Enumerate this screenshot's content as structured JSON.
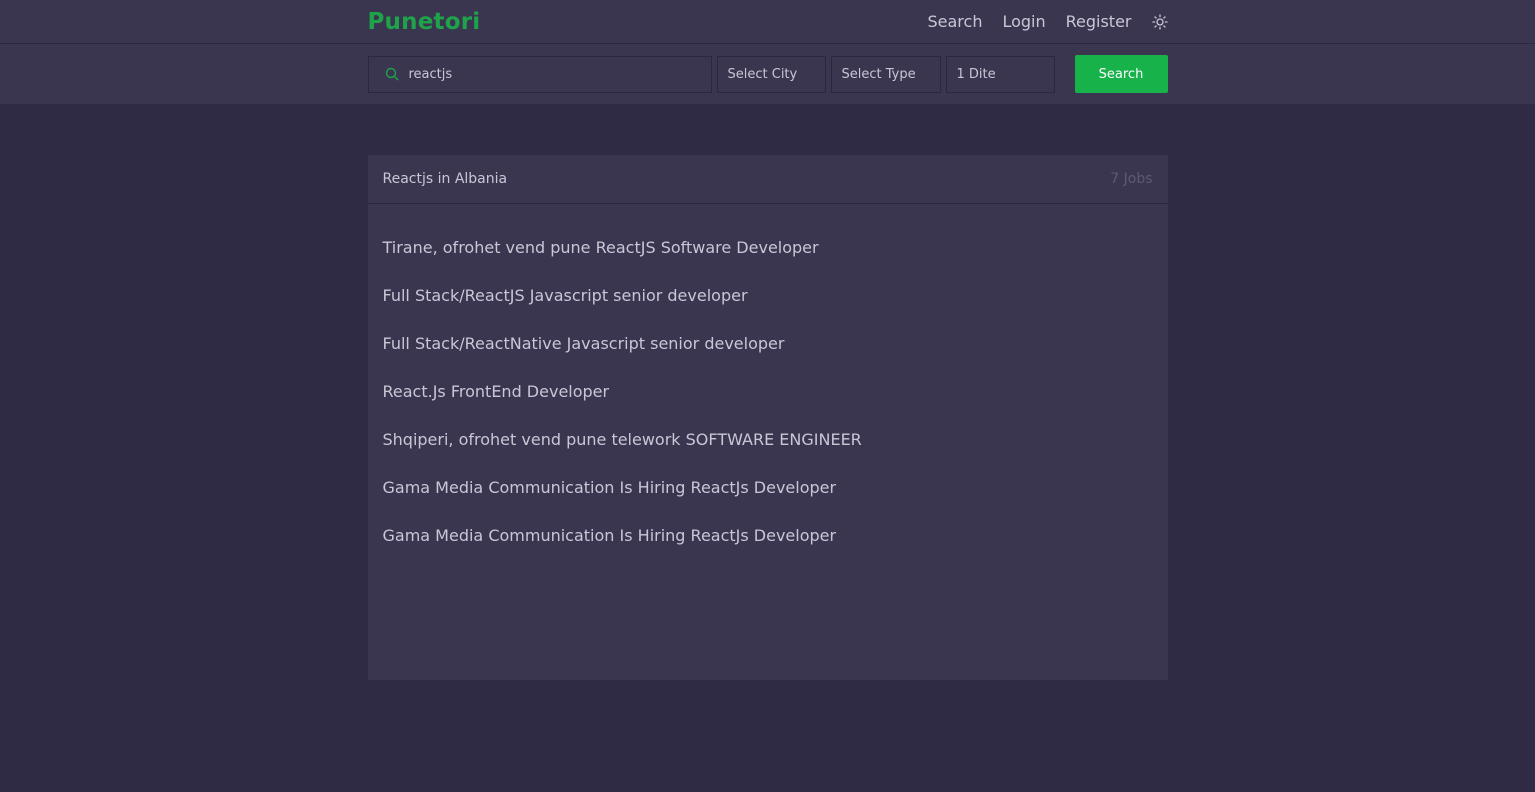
{
  "brand": {
    "logo": "Punetori",
    "accent": "#1fa34a"
  },
  "nav": {
    "search": "Search",
    "login": "Login",
    "register": "Register",
    "theme_icon": "sun-icon"
  },
  "filters": {
    "query": "reactjs",
    "city": "Select City",
    "type": "Select Type",
    "date": "1 Dite",
    "button": "Search"
  },
  "results": {
    "title": "Reactjs in Albania",
    "count": "7 Jobs",
    "jobs": [
      "Tirane, ofrohet vend pune ReactJS Software Developer",
      "Full Stack/ReactJS Javascript senior developer",
      "Full Stack/ReactNative Javascript senior developer",
      "React.Js FrontEnd Developer",
      "Shqiperi, ofrohet vend pune telework SOFTWARE ENGINEER",
      "Gama Media Communication Is Hiring ReactJs Developer",
      "Gama Media Communication Is Hiring ReactJs Developer"
    ]
  }
}
